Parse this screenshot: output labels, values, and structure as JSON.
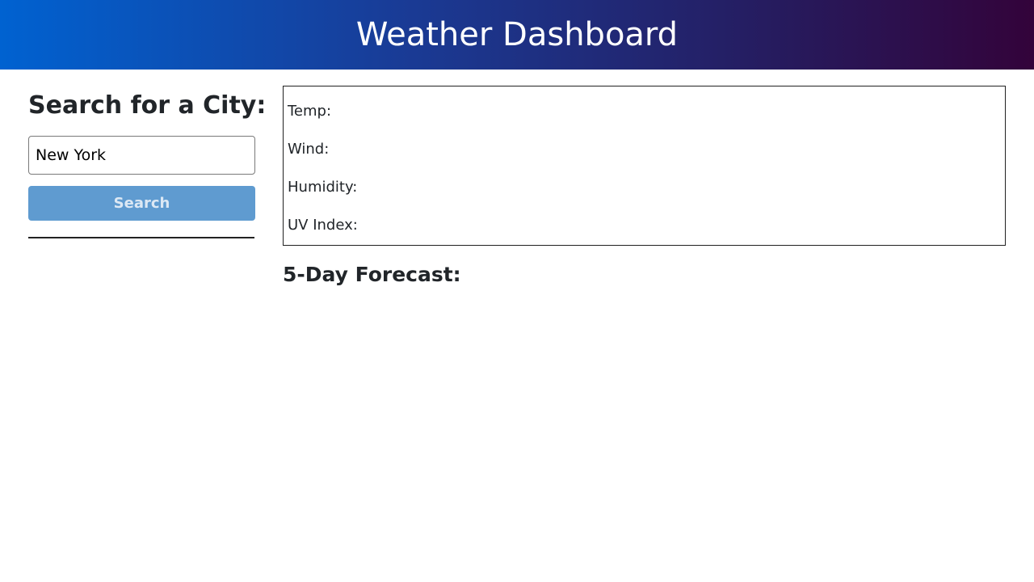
{
  "header": {
    "title": "Weather Dashboard"
  },
  "search": {
    "heading": "Search for a City:",
    "input_value": "New York",
    "button_label": "Search"
  },
  "current": {
    "temp_label": "Temp:",
    "wind_label": "Wind:",
    "humidity_label": "Humidity:",
    "uv_label": "UV Index:"
  },
  "forecast": {
    "heading": "5-Day Forecast:"
  },
  "colors": {
    "header_gradient_start": "#0062d1",
    "header_gradient_end": "#33033a",
    "search_button": "#5f9bd0"
  }
}
